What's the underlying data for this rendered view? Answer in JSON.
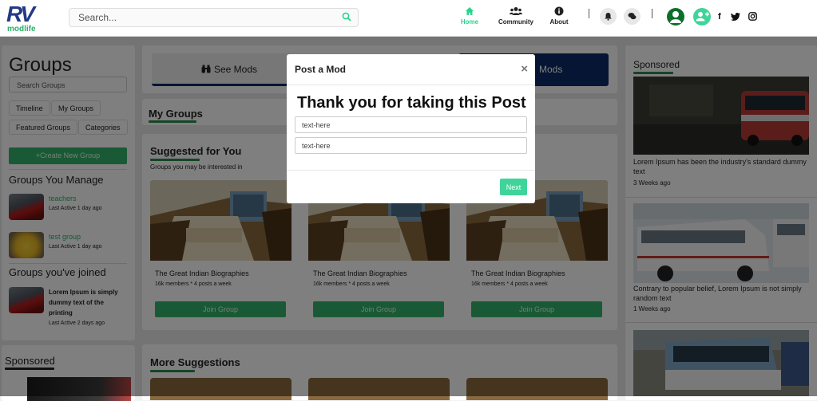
{
  "header": {
    "logo": {
      "mark": "RV",
      "text": "modlife"
    },
    "search": {
      "placeholder": "Search..."
    },
    "nav": [
      {
        "label": "Home",
        "icon": "home-icon",
        "active": true
      },
      {
        "label": "Community",
        "icon": "users-icon",
        "active": false
      },
      {
        "label": "About",
        "icon": "info-icon",
        "active": false
      }
    ],
    "social": [
      "f",
      "t",
      "ig"
    ]
  },
  "colors": {
    "accent": "#2bd28d",
    "button_green": "#34b36a",
    "brand_blue": "#233a86",
    "tab_blue": "#0b2b66"
  },
  "sidebar": {
    "title": "Groups",
    "search_placeholder": "Search Groups",
    "pills": [
      "Timeline",
      "My Groups",
      "Featured Groups",
      "Categories"
    ],
    "create_button": "+Create New Group",
    "manage_title": "Groups You Manage",
    "managed": [
      {
        "name": "teachers",
        "meta": "Last Active 1 day ago"
      },
      {
        "name": "test group",
        "meta": "Last Active 1 day ago"
      }
    ],
    "joined_title": "Groups you've joined",
    "joined": [
      {
        "name": "Lorem Ipsum is simply dummy text of the printing",
        "meta": "Last Active 2 days ago"
      }
    ],
    "sponsored_title": "Sponsored"
  },
  "main": {
    "tabs": [
      {
        "label": "See Mods",
        "icon": "binoculars-icon"
      },
      {
        "label": "Mods"
      }
    ],
    "my_groups": "My Groups",
    "suggested_title": "Suggested for You",
    "suggested_sub": "Groups you may be interested in",
    "cards": [
      {
        "title": "The Great Indian Biographies",
        "meta": "16k members * 4 posts a week",
        "button": "Join Group"
      },
      {
        "title": "The Great Indian Biographies",
        "meta": "16k members * 4 posts a week",
        "button": "Join Group"
      },
      {
        "title": "The Great Indian Biographies",
        "meta": "16k members * 4 posts a week",
        "button": "Join Group"
      }
    ],
    "more_title": "More Suggestions"
  },
  "right": {
    "title": "Sponsored",
    "ads": [
      {
        "text": "Lorem Ipsum has been the industry's standard dummy text",
        "time": "3 Weeks ago"
      },
      {
        "text": "Contrary to popular belief, Lorem Ipsum is not simply random text",
        "time": "1 Weeks ago"
      }
    ]
  },
  "modal": {
    "title": "Post a Mod",
    "close": "×",
    "heading": "Thank you for taking this Post",
    "inputs": [
      {
        "placeholder": "text-here"
      },
      {
        "placeholder": "text-here"
      }
    ],
    "next": "Next"
  }
}
